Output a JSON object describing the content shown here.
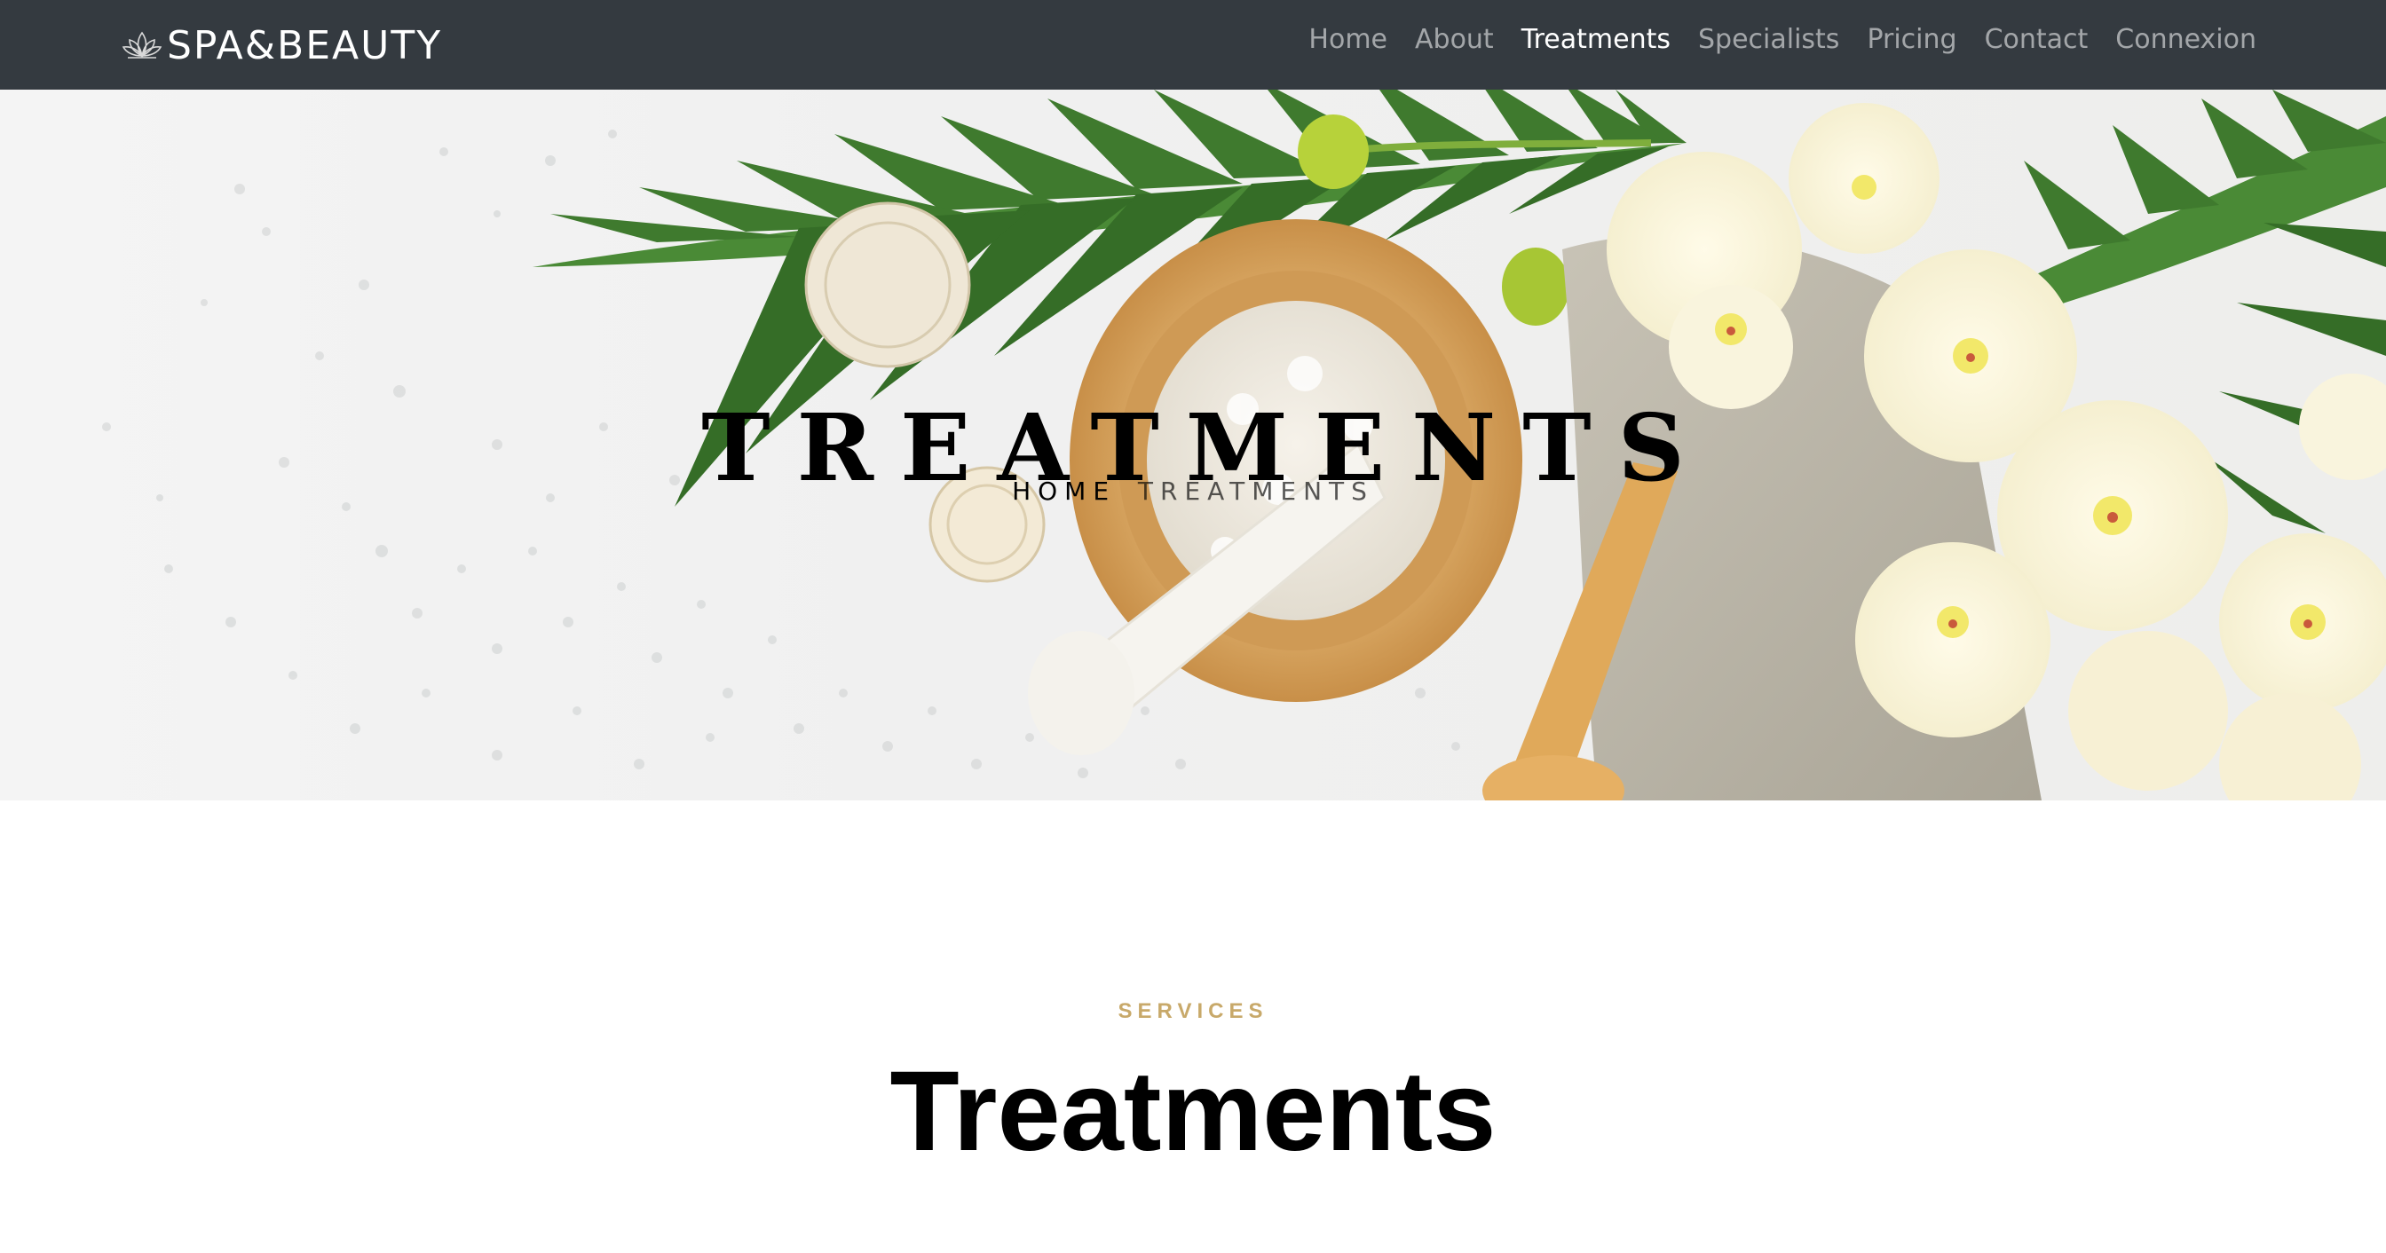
{
  "brand": {
    "name": "SPA&BEAUTY",
    "icon": "lotus-icon"
  },
  "nav": {
    "items": [
      {
        "label": "Home",
        "active": false
      },
      {
        "label": "About",
        "active": false
      },
      {
        "label": "Treatments",
        "active": true
      },
      {
        "label": "Specialists",
        "active": false
      },
      {
        "label": "Pricing",
        "active": false
      },
      {
        "label": "Contact",
        "active": false
      },
      {
        "label": "Connexion",
        "active": false
      }
    ]
  },
  "hero": {
    "title": "TREATMENTS",
    "breadcrumb": {
      "home": "HOME",
      "current": "TREATMENTS"
    },
    "image": "spa-still-life"
  },
  "services": {
    "subheading": "SERVICES",
    "heading": "Treatments"
  },
  "colors": {
    "navbar_bg": "#343a40",
    "accent_gold": "#c8a96a",
    "nav_inactive": "rgba(255,255,255,0.55)",
    "nav_active": "#ffffff"
  }
}
